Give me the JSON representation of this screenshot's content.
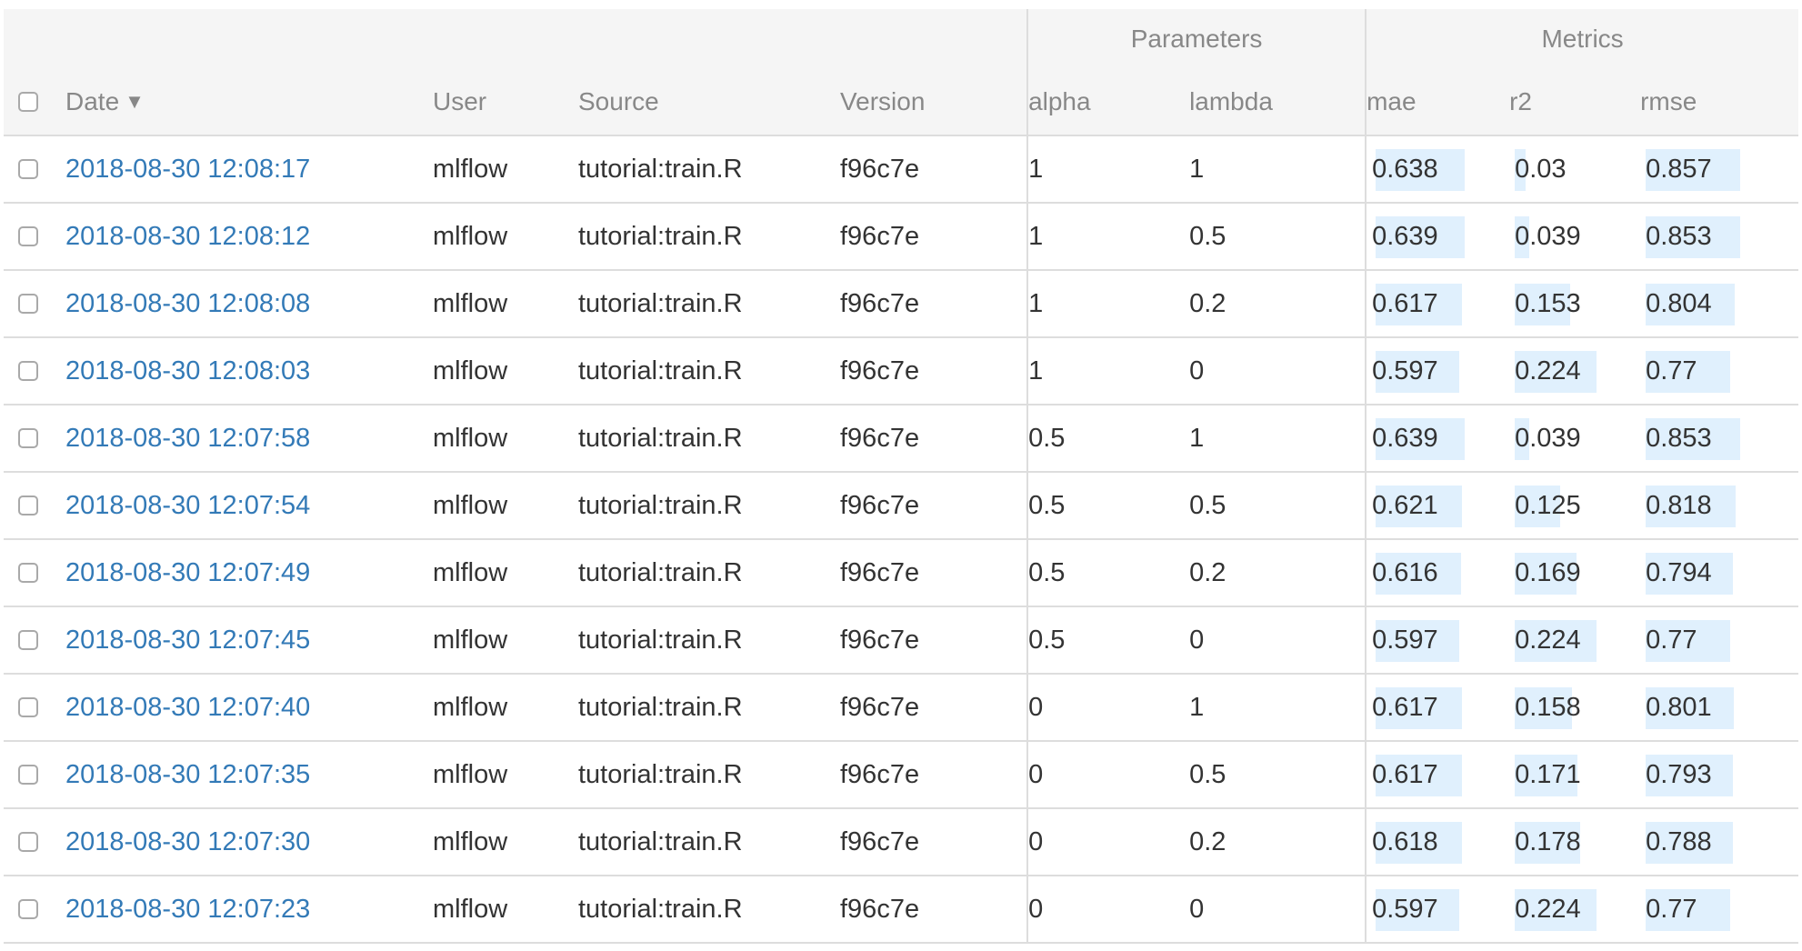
{
  "headers": {
    "parameters": "Parameters",
    "metrics": "Metrics",
    "date": "Date",
    "user": "User",
    "source": "Source",
    "version": "Version",
    "alpha": "alpha",
    "lambda": "lambda",
    "mae": "mae",
    "r2": "r2",
    "rmse": "rmse",
    "sort_indicator": "▼"
  },
  "colors": {
    "link": "#337ab7",
    "metric_bar": "#e0f0fd",
    "header_bg": "#f5f5f5",
    "border": "#dddddd"
  },
  "metric_scale": {
    "mae_max": 0.639,
    "r2_max": 0.224,
    "rmse_max": 0.857
  },
  "rows": [
    {
      "date": "2018-08-30 12:08:17",
      "user": "mlflow",
      "source": "tutorial:train.R",
      "version": "f96c7e",
      "alpha": "1",
      "lambda": "1",
      "mae": "0.638",
      "r2": "0.03",
      "rmse": "0.857"
    },
    {
      "date": "2018-08-30 12:08:12",
      "user": "mlflow",
      "source": "tutorial:train.R",
      "version": "f96c7e",
      "alpha": "1",
      "lambda": "0.5",
      "mae": "0.639",
      "r2": "0.039",
      "rmse": "0.853"
    },
    {
      "date": "2018-08-30 12:08:08",
      "user": "mlflow",
      "source": "tutorial:train.R",
      "version": "f96c7e",
      "alpha": "1",
      "lambda": "0.2",
      "mae": "0.617",
      "r2": "0.153",
      "rmse": "0.804"
    },
    {
      "date": "2018-08-30 12:08:03",
      "user": "mlflow",
      "source": "tutorial:train.R",
      "version": "f96c7e",
      "alpha": "1",
      "lambda": "0",
      "mae": "0.597",
      "r2": "0.224",
      "rmse": "0.77"
    },
    {
      "date": "2018-08-30 12:07:58",
      "user": "mlflow",
      "source": "tutorial:train.R",
      "version": "f96c7e",
      "alpha": "0.5",
      "lambda": "1",
      "mae": "0.639",
      "r2": "0.039",
      "rmse": "0.853"
    },
    {
      "date": "2018-08-30 12:07:54",
      "user": "mlflow",
      "source": "tutorial:train.R",
      "version": "f96c7e",
      "alpha": "0.5",
      "lambda": "0.5",
      "mae": "0.621",
      "r2": "0.125",
      "rmse": "0.818"
    },
    {
      "date": "2018-08-30 12:07:49",
      "user": "mlflow",
      "source": "tutorial:train.R",
      "version": "f96c7e",
      "alpha": "0.5",
      "lambda": "0.2",
      "mae": "0.616",
      "r2": "0.169",
      "rmse": "0.794"
    },
    {
      "date": "2018-08-30 12:07:45",
      "user": "mlflow",
      "source": "tutorial:train.R",
      "version": "f96c7e",
      "alpha": "0.5",
      "lambda": "0",
      "mae": "0.597",
      "r2": "0.224",
      "rmse": "0.77"
    },
    {
      "date": "2018-08-30 12:07:40",
      "user": "mlflow",
      "source": "tutorial:train.R",
      "version": "f96c7e",
      "alpha": "0",
      "lambda": "1",
      "mae": "0.617",
      "r2": "0.158",
      "rmse": "0.801"
    },
    {
      "date": "2018-08-30 12:07:35",
      "user": "mlflow",
      "source": "tutorial:train.R",
      "version": "f96c7e",
      "alpha": "0",
      "lambda": "0.5",
      "mae": "0.617",
      "r2": "0.171",
      "rmse": "0.793"
    },
    {
      "date": "2018-08-30 12:07:30",
      "user": "mlflow",
      "source": "tutorial:train.R",
      "version": "f96c7e",
      "alpha": "0",
      "lambda": "0.2",
      "mae": "0.618",
      "r2": "0.178",
      "rmse": "0.788"
    },
    {
      "date": "2018-08-30 12:07:23",
      "user": "mlflow",
      "source": "tutorial:train.R",
      "version": "f96c7e",
      "alpha": "0",
      "lambda": "0",
      "mae": "0.597",
      "r2": "0.224",
      "rmse": "0.77"
    }
  ]
}
